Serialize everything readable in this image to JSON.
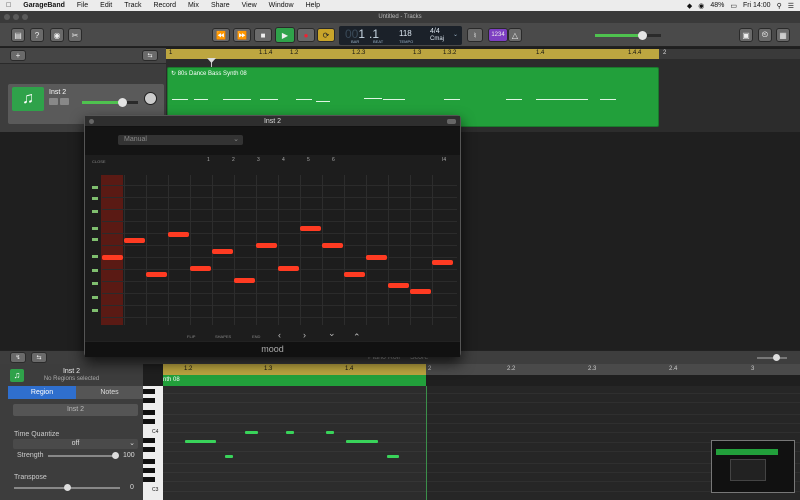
{
  "menubar": {
    "apple": "",
    "app": "GarageBand",
    "items": [
      "File",
      "Edit",
      "Track",
      "Record",
      "Mix",
      "Share",
      "View",
      "Window",
      "Help"
    ],
    "battery": "48%",
    "clock": "Fri 14:00"
  },
  "window": {
    "title": "Untitled - Tracks"
  },
  "lcd": {
    "bar": "1",
    "beat": "1",
    "bar_label": "BAR",
    "beat_label": "BEAT",
    "tempo": "118",
    "tempo_label": "TEMPO",
    "signature": "4/4",
    "key": "Cmaj"
  },
  "toolbar": {
    "count_in": "1234"
  },
  "track": {
    "name": "Inst 2"
  },
  "ruler_top": [
    "1",
    "1.1.4",
    "1.2",
    "1.2.3",
    "1.3",
    "1.3.2",
    "1.4",
    "1.4.4",
    "2"
  ],
  "region_top": {
    "name": "80s Dance Bass Synth 08"
  },
  "plugin": {
    "title": "Inst 2",
    "preset": "Manual",
    "close": "CLOSE",
    "steps": [
      "1",
      "2",
      "3",
      "4",
      "5",
      "6"
    ],
    "loop_label": "I4",
    "bottom": [
      "FLIP",
      "SHAPES",
      "END"
    ],
    "nav": [
      "‹",
      "›",
      "⌄",
      "⌃"
    ],
    "footer": "mood"
  },
  "lower": {
    "piano_roll_tab": "Piano Roll",
    "score_tab": "Score",
    "track_name": "Inst 2",
    "no_regions": "No Regions selected",
    "tabs": [
      "Region",
      "Notes"
    ],
    "region_field": "Inst 2",
    "time_quantize_label": "Time Quantize",
    "time_quantize_value": "off",
    "strength_label": "Strength",
    "strength_value": "100",
    "transpose_label": "Transpose",
    "transpose_value": "0",
    "ruler": [
      "1.2",
      "1.3",
      "1.4",
      "2",
      "2.2",
      "2.3",
      "2.4",
      "3"
    ],
    "region_name": "nth 08",
    "keys": [
      "C4",
      "C3"
    ]
  }
}
